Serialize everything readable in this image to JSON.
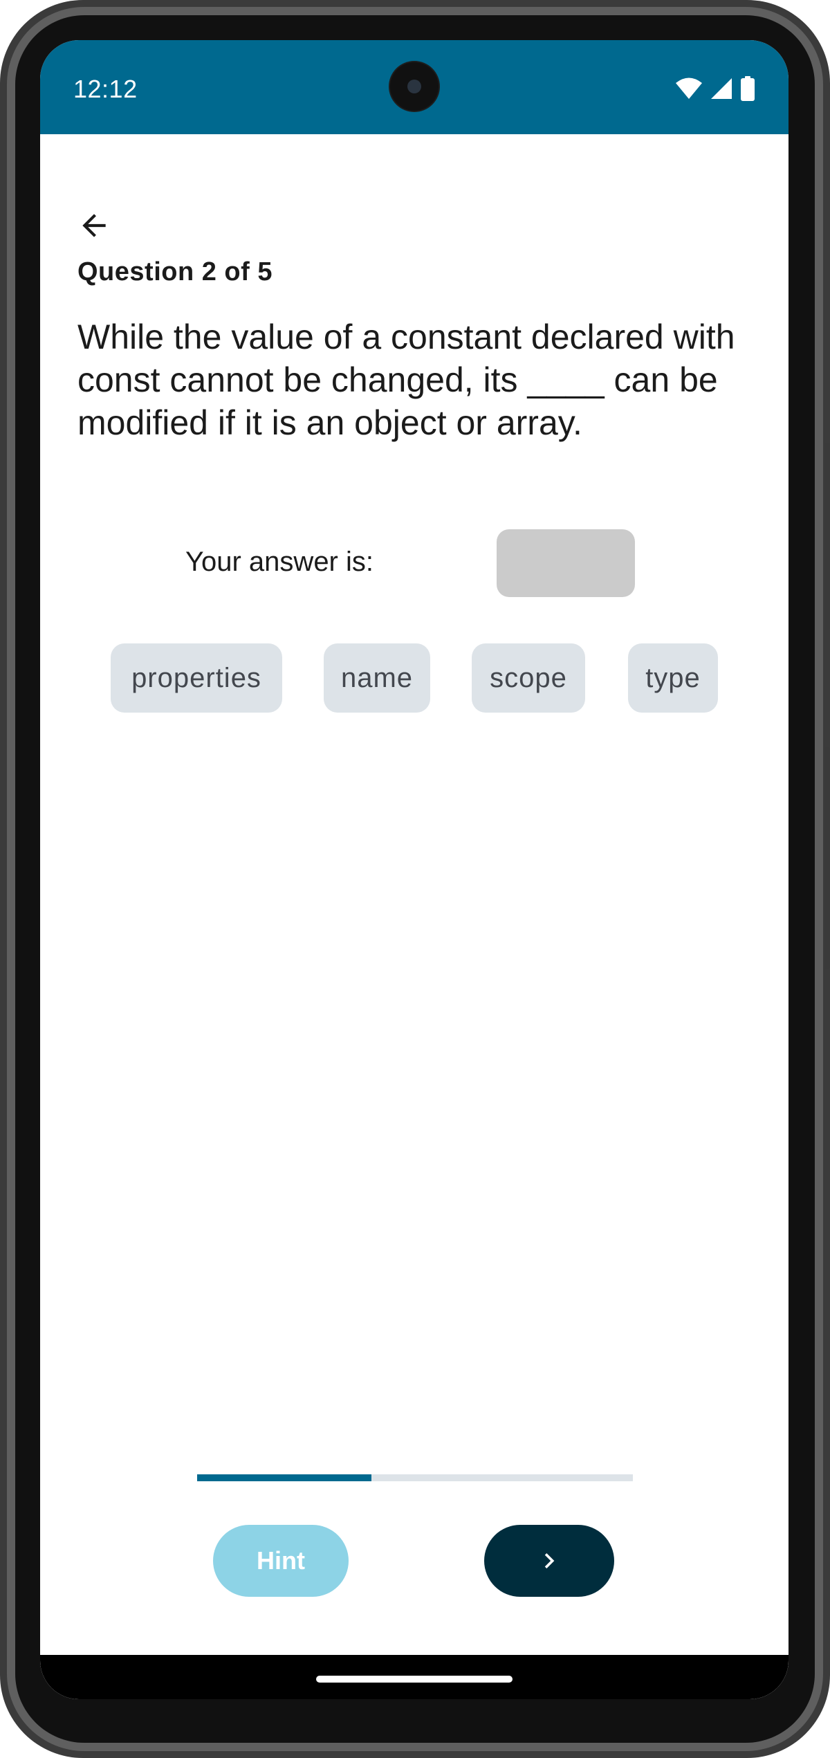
{
  "status_bar": {
    "time": "12:12",
    "background_color": "#00698f",
    "icons": [
      "wifi-icon",
      "signal-icon",
      "battery-icon"
    ]
  },
  "header": {
    "back_icon": "arrow-back-icon"
  },
  "quiz": {
    "counter": "Question 2 of 5",
    "question": "While the value of a constant declared with const cannot be changed, its ____ can be modified if it is an object or array.",
    "answer_label": "Your answer is:",
    "answer_value": "",
    "options": [
      "properties",
      "name",
      "scope",
      "type"
    ]
  },
  "progress": {
    "fraction": 0.4,
    "fill_color": "#00698f",
    "track_color": "#dde3e8"
  },
  "actions": {
    "hint_label": "Hint",
    "hint_color": "#8dd3e6",
    "next_icon": "chevron-right-icon",
    "next_color": "#002d3d"
  }
}
